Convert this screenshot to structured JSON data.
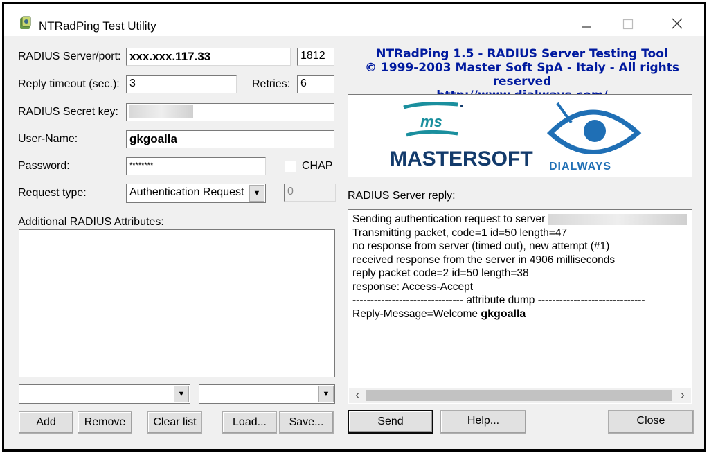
{
  "window": {
    "title": "NTRadPing Test Utility",
    "minimize_icon": "minimize-icon",
    "maximize_icon": "maximize-icon",
    "close_icon": "close-icon"
  },
  "form": {
    "server_label": "RADIUS Server/port:",
    "server_value": "xxx.xxx.117.33",
    "port_value": "1812",
    "timeout_label": "Reply timeout (sec.):",
    "timeout_value": "3",
    "retries_label": "Retries:",
    "retries_value": "6",
    "secret_label": "RADIUS Secret key:",
    "username_label": "User-Name:",
    "username_value": "gkgoalla",
    "password_label": "Password:",
    "password_value": "********",
    "chap_label": "CHAP",
    "chap_checked": false,
    "request_type_label": "Request type:",
    "request_type_value": "Authentication Request",
    "request_code_value": "0",
    "attributes_label": "Additional RADIUS Attributes:"
  },
  "info": {
    "line1": "NTRadPing 1.5 - RADIUS Server Testing Tool",
    "line2": "© 1999-2003 Master Soft SpA - Italy - All rights reserved",
    "line3": "http://www.dialways.com/"
  },
  "logos": {
    "mastersoft_small": "ms",
    "mastersoft_name": "MASTERSOFT",
    "dialways_name": "DIALWAYS"
  },
  "reply": {
    "label": "RADIUS Server reply:",
    "lines": [
      "Sending authentication request to server",
      "Transmitting packet, code=1 id=50 length=47",
      "no response from server (timed out), new attempt (#1)",
      "received response from the server in 4906 milliseconds",
      "reply packet code=2 id=50 length=38",
      "response: Access-Accept",
      "------------------------------- attribute dump ------------------------------",
      "Reply-Message=Welcome"
    ],
    "reply_user": "gkgoalla"
  },
  "buttons": {
    "add": "Add",
    "remove": "Remove",
    "clear_list": "Clear list",
    "load": "Load...",
    "save": "Save...",
    "send": "Send",
    "help": "Help...",
    "close": "Close"
  },
  "colors": {
    "info_text": "#001a9f",
    "mastersoft_teal": "#1a8f9e",
    "mastersoft_navy": "#123a6b",
    "dialways_blue": "#1f6fb5"
  }
}
